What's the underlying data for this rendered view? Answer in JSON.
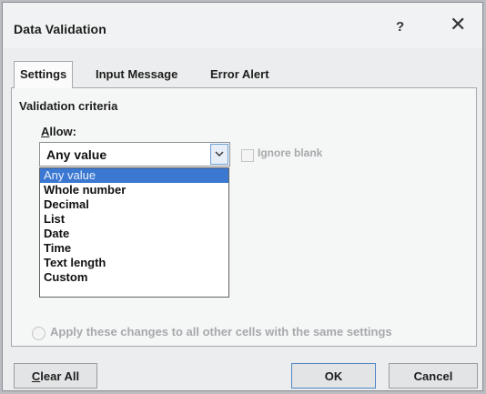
{
  "dialog": {
    "title": "Data Validation",
    "help_glyph": "?",
    "close_glyph": "✕"
  },
  "tabs": [
    {
      "label": "Settings",
      "active": true
    },
    {
      "label": "Input Message",
      "active": false
    },
    {
      "label": "Error Alert",
      "active": false
    }
  ],
  "settings": {
    "group_label": "Validation criteria",
    "allow_label_access": "A",
    "allow_label_rest": "llow:",
    "allow_value": "Any value",
    "ignore_blank_label": "Ignore blank",
    "options": [
      "Any value",
      "Whole number",
      "Decimal",
      "List",
      "Date",
      "Time",
      "Text length",
      "Custom"
    ],
    "selected_index": 0,
    "apply_label": "Apply these changes to all other cells with the same settings"
  },
  "buttons": {
    "clear_all_access": "C",
    "clear_all_rest": "lear All",
    "ok": "OK",
    "cancel": "Cancel"
  },
  "colors": {
    "selection": "#3b78d1",
    "accent_border": "#4f86c6"
  }
}
